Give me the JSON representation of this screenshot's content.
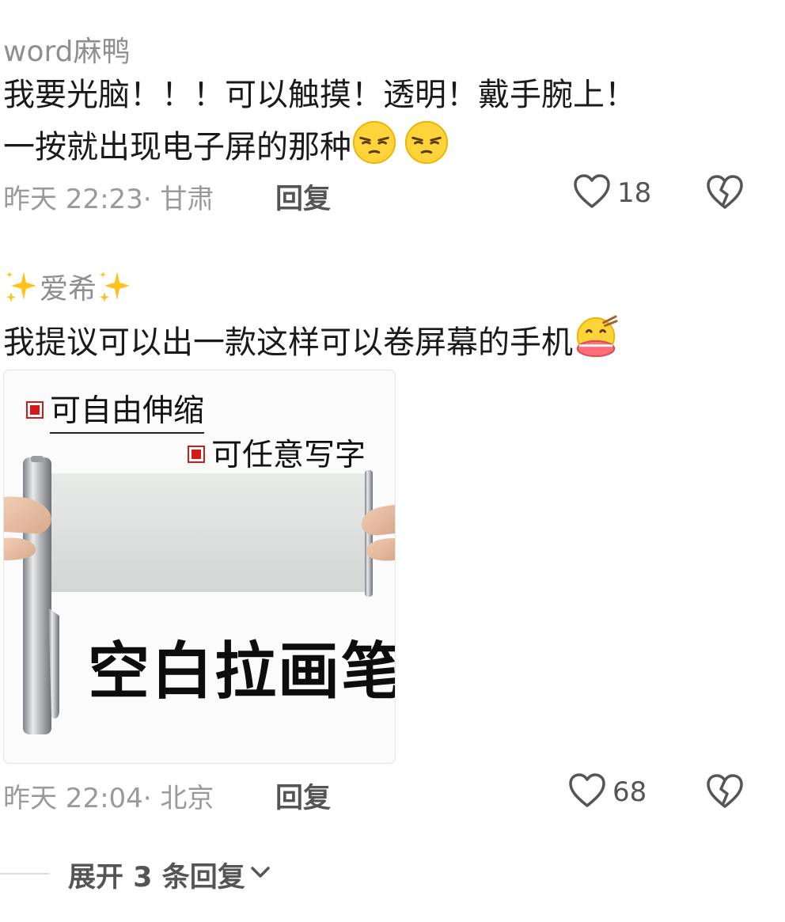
{
  "comments": [
    {
      "username": "word麻鸭",
      "text_line1": "我要光脑！！！可以触摸！透明！戴手腕上！",
      "text_line2": "一按就出现电子屏的那种",
      "emojis": [
        "smirk-emoji",
        "smirk-emoji"
      ],
      "meta": "昨天 22:23· 甘肃",
      "reply_label": "回复",
      "likes": "18"
    },
    {
      "username": "爱希",
      "username_decor": "sparkle-emoji",
      "text": "我提议可以出一款这样可以卷屏幕的手机",
      "emoji": "eating-emoji",
      "image": {
        "badge1": "可自由伸缩",
        "badge2": "可任意写字",
        "title": "空白拉画笔"
      },
      "meta": "昨天 22:04· 北京",
      "reply_label": "回复",
      "likes": "68"
    }
  ],
  "expand_replies": "展开 3 条回复",
  "colors": {
    "username": "#8f8f8f",
    "text": "#1a1a1a",
    "meta": "#9a9a9a",
    "badge_red": "#d21a1a"
  }
}
